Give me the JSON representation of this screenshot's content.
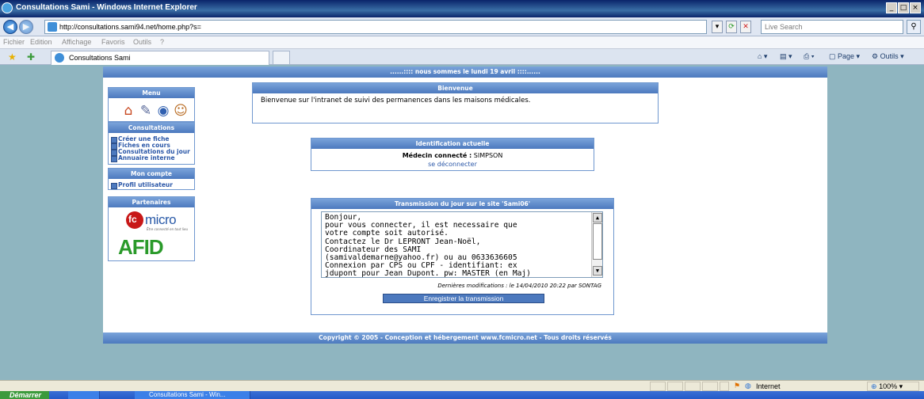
{
  "window": {
    "title": "Consultations Sami - Windows Internet Explorer",
    "controls": [
      "_",
      "□",
      "×"
    ]
  },
  "address_bar": {
    "url": "http://consultations.sami94.net/home.php?s=",
    "search_placeholder": "Live Search"
  },
  "menu_bar": [
    "Fichier",
    "Edition",
    "Affichage",
    "Favoris",
    "Outils",
    "?"
  ],
  "tabs": [
    {
      "label": "Consultations Sami"
    }
  ],
  "command_bar": {
    "page_label": "Page",
    "tools_label": "Outils"
  },
  "page": {
    "date_banner": "......:::: nous sommes le lundi 19 avril ::::......",
    "sidebar": {
      "menu": {
        "title": "Menu",
        "icons": [
          "home-icon",
          "tools-icon",
          "disk-icon",
          "users-icon"
        ]
      },
      "consultations": {
        "title": "Consultations",
        "links": [
          "Créer une fiche",
          "Fiches en cours",
          "Consultations du jour",
          "Annuaire interne"
        ]
      },
      "account": {
        "title": "Mon compte",
        "links": [
          "Profil utilisateur"
        ]
      },
      "partners": {
        "title": "Partenaires",
        "fcmicro_logo": {
          "text": "micro",
          "tagline": "Être connecté en tout lieu"
        },
        "afid_logo": {
          "text": "AFID"
        }
      }
    },
    "welcome": {
      "title": "Bienvenue",
      "text": "Bienvenue sur l'intranet de suivi des permanences dans les maisons médicales."
    },
    "identification": {
      "title": "Identification actuelle",
      "doctor_label": "Médecin connecté :",
      "doctor_name": "SIMPSON",
      "logout_label": "se déconnecter"
    },
    "transmission": {
      "title": "Transmission du jour sur le site 'Sami06'",
      "message_lines": [
        "Bonjour,",
        "pour vous connecter, il est necessaire que",
        "votre compte soit autorisé.",
        "Contactez le Dr LEPRONT Jean-Noël,",
        "Coordinateur des SAMI",
        "(samivaldemarne@yahoo.fr) ou au 0633636605",
        "Connexion par CPS ou CPF - identifiant: ex",
        "jdupont pour Jean Dupont. pw: MASTER (en Maj)"
      ],
      "last_modified": "Dernières modifications : le 14/04/2010 20:22 par SONTAG",
      "save_label": "Enregistrer la transmission"
    },
    "footer": "Copyright © 2005 - Conception et hébergement www.fcmicro.net - Tous droits réservés"
  },
  "status_bar": {
    "zone": "Internet",
    "zoom": "100%"
  },
  "taskbar": {
    "start_label": "Démarrer",
    "window_button": "Consultations Sami - Win..."
  }
}
